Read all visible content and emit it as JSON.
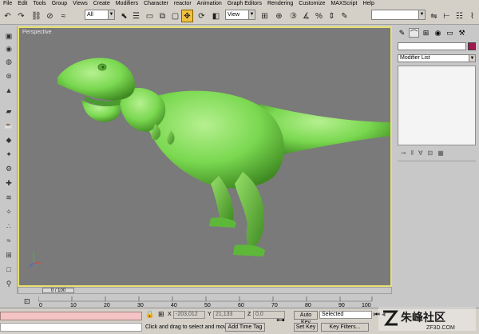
{
  "menu": [
    "File",
    "Edit",
    "Tools",
    "Group",
    "Views",
    "Create",
    "Modifiers",
    "Character",
    "reactor",
    "Animation",
    "Graph Editors",
    "Rendering",
    "Customize",
    "MAXScript",
    "Help"
  ],
  "toolbar": {
    "selection_filter": "All",
    "reference_coord": "View"
  },
  "viewport": {
    "label": "Perspective",
    "model": "T-Rex",
    "model_color": "#7ad850",
    "background": "#7a7a7a",
    "border_color": "#e8e070"
  },
  "command_panel": {
    "modifier_list": "Modifier List",
    "swatch_color": "#a0184c"
  },
  "timeline": {
    "slider_label": "0 / 100",
    "ticks": [
      "0",
      "10",
      "20",
      "30",
      "40",
      "50",
      "60",
      "70",
      "80",
      "90",
      "100"
    ]
  },
  "status": {
    "prompt": "Click and drag to select and move",
    "x_label": "X",
    "x_value": "-203,012",
    "y_label": "Y",
    "y_value": "21,133",
    "z_label": "Z",
    "z_value": "0,0",
    "add_time_tag": "Add Time Tag",
    "auto_key": "Auto Key",
    "set_key": "Set Key",
    "selected": "Selected",
    "key_filters": "Key Filters..."
  },
  "watermark": {
    "brand": "朱峰社区",
    "url": "ZF3D.COM"
  }
}
